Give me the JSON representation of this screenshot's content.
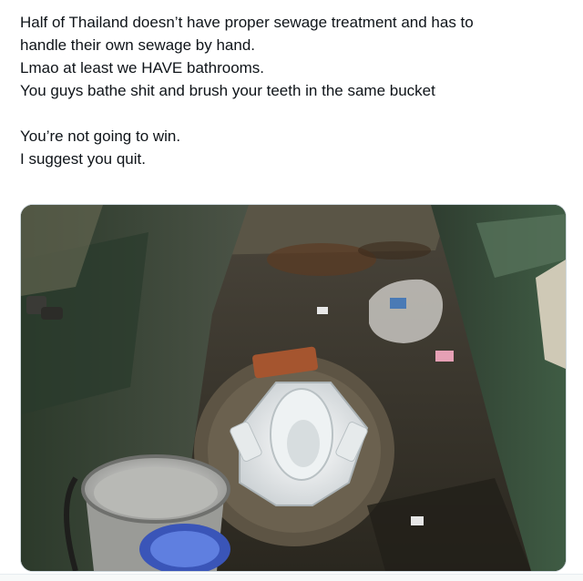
{
  "tweet": {
    "text_lines": [
      "Half of Thailand doesn’t have proper sewage treatment and has to",
      "handle their own sewage by hand.",
      "Lmao at least we HAVE bathrooms.",
      "You guys bathe shit and brush your teeth in the same bucket"
    ],
    "text_lines_2": [
      "You’re not going to win.",
      "I suggest you quit."
    ],
    "media": {
      "kind": "photo",
      "icons": [
        "squat-toilet",
        "water-bucket",
        "blue-scoop",
        "plastic-bag"
      ]
    }
  }
}
